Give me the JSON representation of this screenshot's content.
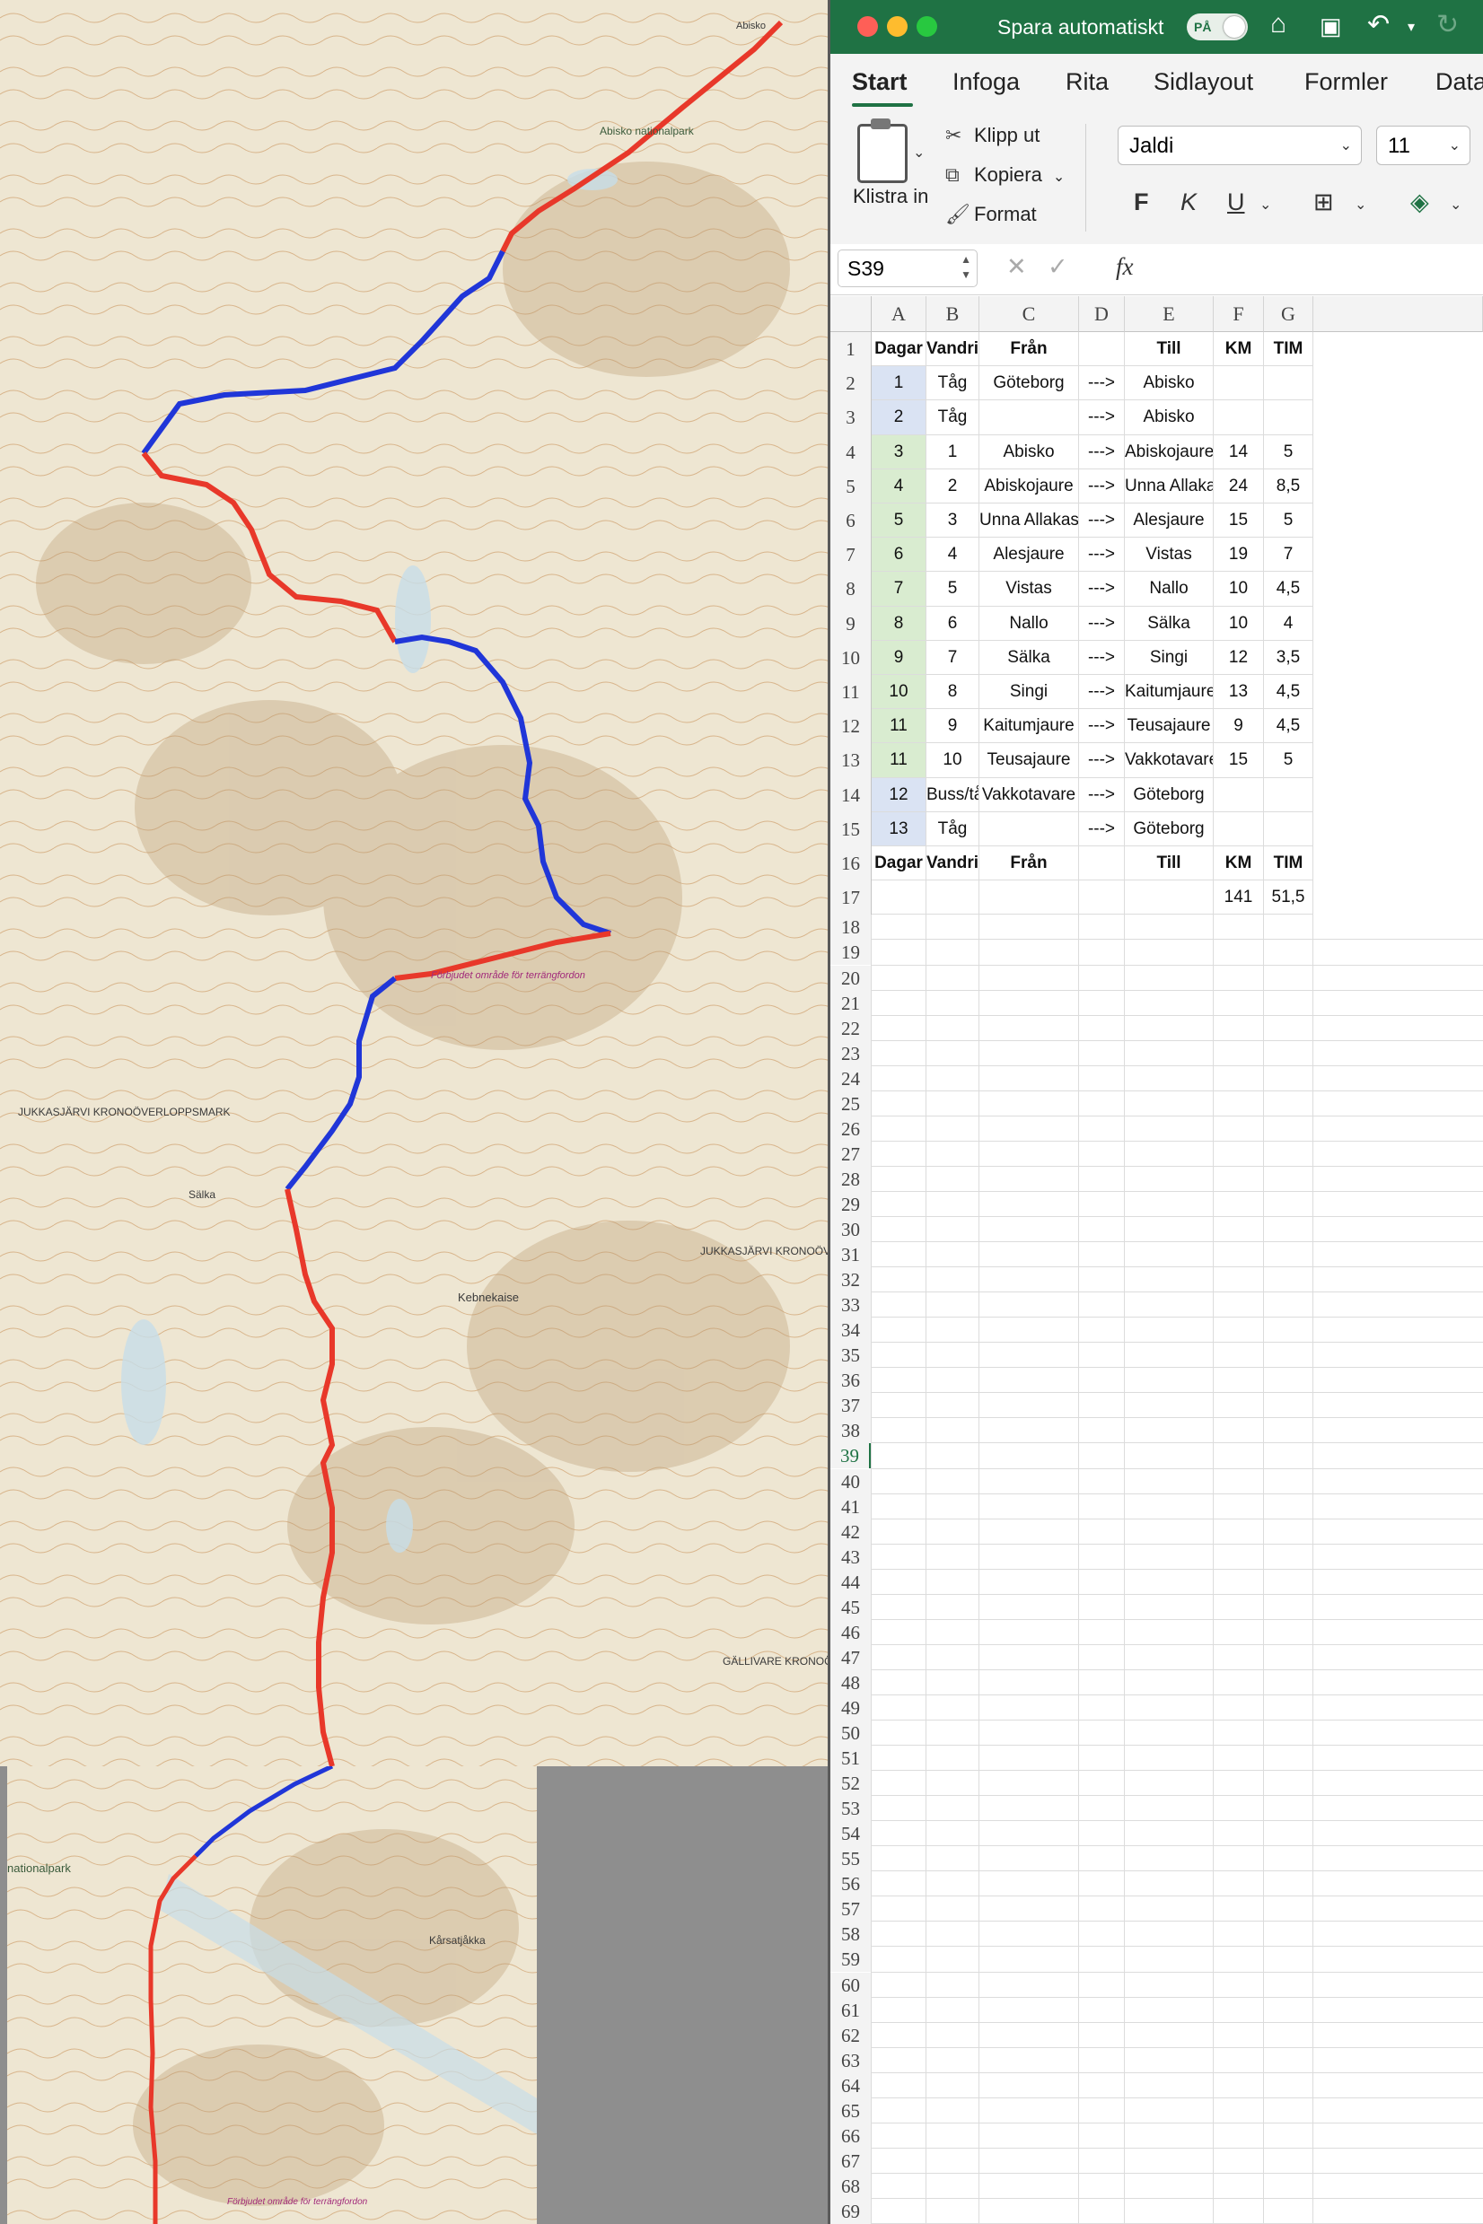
{
  "excel": {
    "titlebar": {
      "autosave_label": "Spara automatiskt",
      "autosave_state": "PÅ"
    },
    "tabs": [
      "Start",
      "Infoga",
      "Rita",
      "Sidlayout",
      "Formler",
      "Data"
    ],
    "active_tab": "Start",
    "clipboard": {
      "paste": "Klistra in",
      "cut": "Klipp ut",
      "copy": "Kopiera",
      "format": "Format"
    },
    "font": {
      "name": "Jaldi",
      "size": "11"
    },
    "format_buttons": {
      "bold": "F",
      "italic": "K",
      "underline": "U"
    },
    "namebox": "S39",
    "fx": "fx",
    "columns": [
      "A",
      "B",
      "C",
      "D",
      "E",
      "F",
      "G"
    ],
    "selected_row": "39",
    "rows": [
      {
        "n": "1",
        "fill": "",
        "cells": [
          "Dagar",
          "Vandring",
          "Från",
          "",
          "Till",
          "KM",
          "TIM"
        ],
        "bold": true
      },
      {
        "n": "2",
        "fill": "blue",
        "cells": [
          "1",
          "Tåg",
          "Göteborg",
          "--->",
          "Abisko",
          "",
          ""
        ]
      },
      {
        "n": "3",
        "fill": "blue",
        "cells": [
          "2",
          "Tåg",
          "",
          "--->",
          "Abisko",
          "",
          ""
        ]
      },
      {
        "n": "4",
        "fill": "green",
        "cells": [
          "3",
          "1",
          "Abisko",
          "--->",
          "Abiskojaure",
          "14",
          "5"
        ]
      },
      {
        "n": "5",
        "fill": "green",
        "cells": [
          "4",
          "2",
          "Abiskojaure",
          "--->",
          "Unna Allakas",
          "24",
          "8,5"
        ]
      },
      {
        "n": "6",
        "fill": "green",
        "cells": [
          "5",
          "3",
          "Unna Allakas",
          "--->",
          "Alesjaure",
          "15",
          "5"
        ]
      },
      {
        "n": "7",
        "fill": "green",
        "cells": [
          "6",
          "4",
          "Alesjaure",
          "--->",
          "Vistas",
          "19",
          "7"
        ]
      },
      {
        "n": "8",
        "fill": "green",
        "cells": [
          "7",
          "5",
          "Vistas",
          "--->",
          "Nallo",
          "10",
          "4,5"
        ]
      },
      {
        "n": "9",
        "fill": "green",
        "cells": [
          "8",
          "6",
          "Nallo",
          "--->",
          "Sälka",
          "10",
          "4"
        ]
      },
      {
        "n": "10",
        "fill": "green",
        "cells": [
          "9",
          "7",
          "Sälka",
          "--->",
          "Singi",
          "12",
          "3,5"
        ]
      },
      {
        "n": "11",
        "fill": "green",
        "cells": [
          "10",
          "8",
          "Singi",
          "--->",
          "Kaitumjaure",
          "13",
          "4,5"
        ]
      },
      {
        "n": "12",
        "fill": "green",
        "cells": [
          "11",
          "9",
          "Kaitumjaure",
          "--->",
          "Teusajaure",
          "9",
          "4,5"
        ]
      },
      {
        "n": "13",
        "fill": "green",
        "cells": [
          "11",
          "10",
          "Teusajaure",
          "--->",
          "Vakkotavare",
          "15",
          "5"
        ]
      },
      {
        "n": "14",
        "fill": "blue",
        "cells": [
          "12",
          "Buss/tåg",
          "Vakkotavare",
          "--->",
          "Göteborg",
          "",
          ""
        ]
      },
      {
        "n": "15",
        "fill": "blue",
        "cells": [
          "13",
          "Tåg",
          "",
          "--->",
          "Göteborg",
          "",
          ""
        ]
      },
      {
        "n": "16",
        "fill": "",
        "cells": [
          "Dagar",
          "Vandring",
          "Från",
          "",
          "Till",
          "KM",
          "TIM"
        ],
        "bold": true
      },
      {
        "n": "17",
        "fill": "",
        "cells": [
          "",
          "",
          "",
          "",
          "",
          "141",
          "51,5"
        ]
      }
    ],
    "colors": {
      "green_brand": "#1f7244",
      "blue_fill": "#dae3f3",
      "green_fill": "#d9ecd0"
    }
  },
  "map": {
    "labels": {
      "abisko_np": "Abisko nationalpark",
      "jukkasjarvi": "JUKKASJÄRVI KRONOÖVERLOPPSMARK",
      "jukkasjarvi2": "JUKKASJÄRVI KRONOÖV",
      "gallivare": "GÄLLIVARE KRONOÖ",
      "kebnekaise": "Kebnekaise",
      "forbjudet": "Förbjudet område för terrängfordon",
      "salka": "Sälka",
      "nationalpark": "nationalpark",
      "karsatjakka": "Kårsatjåkka",
      "abisko": "Abisko"
    },
    "route_colors": {
      "train": "#e8382a",
      "bus": "#2036d8"
    }
  }
}
